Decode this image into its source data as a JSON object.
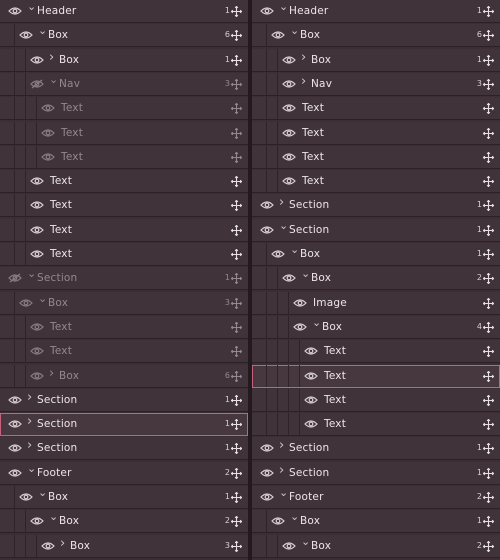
{
  "panels": [
    {
      "rows": [
        {
          "label": "Header",
          "depth": 0,
          "chevron": "down",
          "count": "1",
          "dim": false,
          "selected": false,
          "eye": "eye-icon"
        },
        {
          "label": "Box",
          "depth": 1,
          "chevron": "down",
          "count": "6",
          "dim": false,
          "selected": false,
          "eye": "eye-icon"
        },
        {
          "label": "Box",
          "depth": 2,
          "chevron": "right",
          "count": "1",
          "dim": false,
          "selected": false,
          "eye": "eye-icon"
        },
        {
          "label": "Nav",
          "depth": 2,
          "chevron": "down",
          "count": "3",
          "dim": true,
          "selected": false,
          "eye": "eye-off-icon"
        },
        {
          "label": "Text",
          "depth": 3,
          "chevron": "",
          "count": "",
          "dim": true,
          "selected": false,
          "eye": "eye-icon"
        },
        {
          "label": "Text",
          "depth": 3,
          "chevron": "",
          "count": "",
          "dim": true,
          "selected": false,
          "eye": "eye-icon"
        },
        {
          "label": "Text",
          "depth": 3,
          "chevron": "",
          "count": "",
          "dim": true,
          "selected": false,
          "eye": "eye-icon"
        },
        {
          "label": "Text",
          "depth": 2,
          "chevron": "",
          "count": "",
          "dim": false,
          "selected": false,
          "eye": "eye-icon"
        },
        {
          "label": "Text",
          "depth": 2,
          "chevron": "",
          "count": "",
          "dim": false,
          "selected": false,
          "eye": "eye-icon"
        },
        {
          "label": "Text",
          "depth": 2,
          "chevron": "",
          "count": "",
          "dim": false,
          "selected": false,
          "eye": "eye-icon"
        },
        {
          "label": "Text",
          "depth": 2,
          "chevron": "",
          "count": "",
          "dim": false,
          "selected": false,
          "eye": "eye-icon"
        },
        {
          "label": "Section",
          "depth": 0,
          "chevron": "down",
          "count": "1",
          "dim": true,
          "selected": false,
          "eye": "eye-off-icon"
        },
        {
          "label": "Box",
          "depth": 1,
          "chevron": "down",
          "count": "3",
          "dim": true,
          "selected": false,
          "eye": "eye-icon"
        },
        {
          "label": "Text",
          "depth": 2,
          "chevron": "",
          "count": "",
          "dim": true,
          "selected": false,
          "eye": "eye-icon"
        },
        {
          "label": "Text",
          "depth": 2,
          "chevron": "",
          "count": "",
          "dim": true,
          "selected": false,
          "eye": "eye-icon"
        },
        {
          "label": "Box",
          "depth": 2,
          "chevron": "right",
          "count": "6",
          "dim": true,
          "selected": false,
          "eye": "eye-icon"
        },
        {
          "label": "Section",
          "depth": 0,
          "chevron": "right",
          "count": "1",
          "dim": false,
          "selected": false,
          "eye": "eye-icon"
        },
        {
          "label": "Section",
          "depth": 0,
          "chevron": "right",
          "count": "1",
          "dim": false,
          "selected": true,
          "eye": "eye-icon"
        },
        {
          "label": "Section",
          "depth": 0,
          "chevron": "right",
          "count": "1",
          "dim": false,
          "selected": false,
          "eye": "eye-icon"
        },
        {
          "label": "Footer",
          "depth": 0,
          "chevron": "down",
          "count": "2",
          "dim": false,
          "selected": false,
          "eye": "eye-icon"
        },
        {
          "label": "Box",
          "depth": 1,
          "chevron": "down",
          "count": "1",
          "dim": false,
          "selected": false,
          "eye": "eye-icon"
        },
        {
          "label": "Box",
          "depth": 2,
          "chevron": "down",
          "count": "2",
          "dim": false,
          "selected": false,
          "eye": "eye-icon"
        },
        {
          "label": "Box",
          "depth": 3,
          "chevron": "right",
          "count": "3",
          "dim": false,
          "selected": false,
          "eye": "eye-icon"
        }
      ]
    },
    {
      "rows": [
        {
          "label": "Header",
          "depth": 0,
          "chevron": "down",
          "count": "1",
          "dim": false,
          "selected": false,
          "eye": "eye-icon"
        },
        {
          "label": "Box",
          "depth": 1,
          "chevron": "down",
          "count": "6",
          "dim": false,
          "selected": false,
          "eye": "eye-icon"
        },
        {
          "label": "Box",
          "depth": 2,
          "chevron": "right",
          "count": "1",
          "dim": false,
          "selected": false,
          "eye": "eye-icon"
        },
        {
          "label": "Nav",
          "depth": 2,
          "chevron": "right",
          "count": "3",
          "dim": false,
          "selected": false,
          "eye": "eye-icon"
        },
        {
          "label": "Text",
          "depth": 2,
          "chevron": "",
          "count": "",
          "dim": false,
          "selected": false,
          "eye": "eye-icon"
        },
        {
          "label": "Text",
          "depth": 2,
          "chevron": "",
          "count": "",
          "dim": false,
          "selected": false,
          "eye": "eye-icon"
        },
        {
          "label": "Text",
          "depth": 2,
          "chevron": "",
          "count": "",
          "dim": false,
          "selected": false,
          "eye": "eye-icon"
        },
        {
          "label": "Text",
          "depth": 2,
          "chevron": "",
          "count": "",
          "dim": false,
          "selected": false,
          "eye": "eye-icon"
        },
        {
          "label": "Section",
          "depth": 0,
          "chevron": "right",
          "count": "1",
          "dim": false,
          "selected": false,
          "eye": "eye-icon"
        },
        {
          "label": "Section",
          "depth": 0,
          "chevron": "down",
          "count": "1",
          "dim": false,
          "selected": false,
          "eye": "eye-icon"
        },
        {
          "label": "Box",
          "depth": 1,
          "chevron": "down",
          "count": "1",
          "dim": false,
          "selected": false,
          "eye": "eye-icon"
        },
        {
          "label": "Box",
          "depth": 2,
          "chevron": "down",
          "count": "2",
          "dim": false,
          "selected": false,
          "eye": "eye-icon"
        },
        {
          "label": "Image",
          "depth": 3,
          "chevron": "",
          "count": "",
          "dim": false,
          "selected": false,
          "eye": "eye-icon"
        },
        {
          "label": "Box",
          "depth": 3,
          "chevron": "down",
          "count": "4",
          "dim": false,
          "selected": false,
          "eye": "eye-icon"
        },
        {
          "label": "Text",
          "depth": 4,
          "chevron": "",
          "count": "",
          "dim": false,
          "selected": false,
          "eye": "eye-icon"
        },
        {
          "label": "Text",
          "depth": 4,
          "chevron": "",
          "count": "",
          "dim": false,
          "selected": true,
          "eye": "eye-icon"
        },
        {
          "label": "Text",
          "depth": 4,
          "chevron": "",
          "count": "",
          "dim": false,
          "selected": false,
          "eye": "eye-icon"
        },
        {
          "label": "Text",
          "depth": 4,
          "chevron": "",
          "count": "",
          "dim": false,
          "selected": false,
          "eye": "eye-icon"
        },
        {
          "label": "Section",
          "depth": 0,
          "chevron": "right",
          "count": "1",
          "dim": false,
          "selected": false,
          "eye": "eye-icon"
        },
        {
          "label": "Section",
          "depth": 0,
          "chevron": "right",
          "count": "1",
          "dim": false,
          "selected": false,
          "eye": "eye-icon"
        },
        {
          "label": "Footer",
          "depth": 0,
          "chevron": "down",
          "count": "2",
          "dim": false,
          "selected": false,
          "eye": "eye-icon"
        },
        {
          "label": "Box",
          "depth": 1,
          "chevron": "down",
          "count": "1",
          "dim": false,
          "selected": false,
          "eye": "eye-icon"
        },
        {
          "label": "Box",
          "depth": 2,
          "chevron": "down",
          "count": "2",
          "dim": false,
          "selected": false,
          "eye": "eye-icon"
        }
      ]
    }
  ],
  "colors": {
    "row_bg": "#41333a",
    "selected_outline": "#c9607f",
    "text": "#ece6e8",
    "dim_text": "#948890"
  },
  "icons": {
    "visibility": "eye-icon",
    "hidden": "eye-off-icon",
    "move": "move-icon",
    "expand": "chevron-right-icon",
    "collapse": "chevron-down-icon"
  }
}
